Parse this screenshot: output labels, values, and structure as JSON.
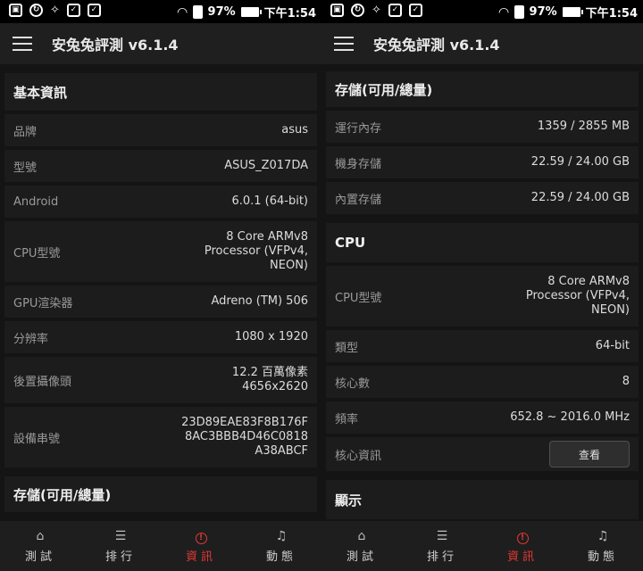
{
  "status_bar": {
    "battery": "97%",
    "time": "下午1:54"
  },
  "app": {
    "title": "安兔兔評測 v6.1.4"
  },
  "left": {
    "basic": {
      "title": "基本資訊",
      "rows": [
        {
          "label": "品牌",
          "value": "asus"
        },
        {
          "label": "型號",
          "value": "ASUS_Z017DA"
        },
        {
          "label": "Android",
          "value": "6.0.1 (64-bit)"
        },
        {
          "label": "CPU型號",
          "value": "8 Core ARMv8\nProcessor (VFPv4,\nNEON)"
        },
        {
          "label": "GPU渲染器",
          "value": "Adreno (TM) 506"
        },
        {
          "label": "分辨率",
          "value": "1080 x 1920"
        },
        {
          "label": "後置攝像頭",
          "value": "12.2 百萬像素\n4656x2620"
        },
        {
          "label": "設備串號",
          "value": "23D89EAE83F8B176F\n8AC3BBB4D46C0818\nA38ABCF"
        }
      ]
    },
    "storage_title": "存儲(可用/總量)"
  },
  "right": {
    "storage": {
      "title": "存儲(可用/總量)",
      "rows": [
        {
          "label": "運行內存",
          "value": "1359 / 2855 MB"
        },
        {
          "label": "機身存儲",
          "value": "22.59 / 24.00 GB"
        },
        {
          "label": "內置存儲",
          "value": "22.59 / 24.00 GB"
        }
      ]
    },
    "cpu": {
      "title": "CPU",
      "rows": [
        {
          "label": "CPU型號",
          "value": "8 Core ARMv8\nProcessor (VFPv4,\nNEON)"
        },
        {
          "label": "類型",
          "value": "64-bit"
        },
        {
          "label": "核心數",
          "value": "8"
        },
        {
          "label": "頻率",
          "value": "652.8 ~ 2016.0 MHz"
        },
        {
          "label": "核心資訊",
          "button": "查看"
        }
      ]
    },
    "display_title": "顯示"
  },
  "nav": [
    {
      "label": "測試",
      "icon": "home-icon",
      "active": false
    },
    {
      "label": "排行",
      "icon": "list-icon",
      "active": false
    },
    {
      "label": "資訊",
      "icon": "alert-icon",
      "active": true
    },
    {
      "label": "動態",
      "icon": "bell-icon",
      "active": false
    }
  ],
  "colors": {
    "accent": "#e53935",
    "background": "#141414",
    "card": "#1c1c1c",
    "appbar": "#1f1f1f"
  }
}
